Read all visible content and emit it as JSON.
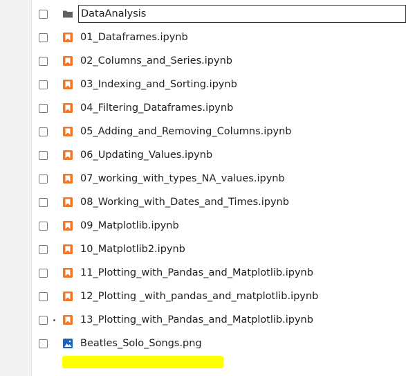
{
  "colors": {
    "notebook_icon": "#f37626",
    "folder_icon": "#616161",
    "image_icon": "#1565c0",
    "running_indicator": "#2e7d32",
    "highlight": "#ffff00"
  },
  "items": [
    {
      "name": "DataAnalysis",
      "icon": "folder-icon",
      "renaming": true
    },
    {
      "name": "01_Dataframes.ipynb",
      "icon": "notebook-icon"
    },
    {
      "name": "02_Columns_and_Series.ipynb",
      "icon": "notebook-icon"
    },
    {
      "name": "03_Indexing_and_Sorting.ipynb",
      "icon": "notebook-icon"
    },
    {
      "name": "04_Filtering_Dataframes.ipynb",
      "icon": "notebook-icon"
    },
    {
      "name": "05_Adding_and_Removing_Columns.ipynb",
      "icon": "notebook-icon"
    },
    {
      "name": "06_Updating_Values.ipynb",
      "icon": "notebook-icon"
    },
    {
      "name": "07_working_with_types_NA_values.ipynb",
      "icon": "notebook-icon"
    },
    {
      "name": "08_Working_with_Dates_and_Times.ipynb",
      "icon": "notebook-icon"
    },
    {
      "name": "09_Matplotlib.ipynb",
      "icon": "notebook-icon"
    },
    {
      "name": "10_Matplotlib2.ipynb",
      "icon": "notebook-icon"
    },
    {
      "name": "11_Plotting_with_Pandas_and_Matplotlib.ipynb",
      "icon": "notebook-icon"
    },
    {
      "name": "12_Plotting _with_pandas_and_matplotlib.ipynb",
      "icon": "notebook-icon"
    },
    {
      "name": "13_Plotting_with_Pandas_and_Matplotlib.ipynb",
      "icon": "notebook-icon",
      "running": true
    },
    {
      "name": "Beatles_Solo_Songs.png",
      "icon": "image-icon"
    }
  ]
}
